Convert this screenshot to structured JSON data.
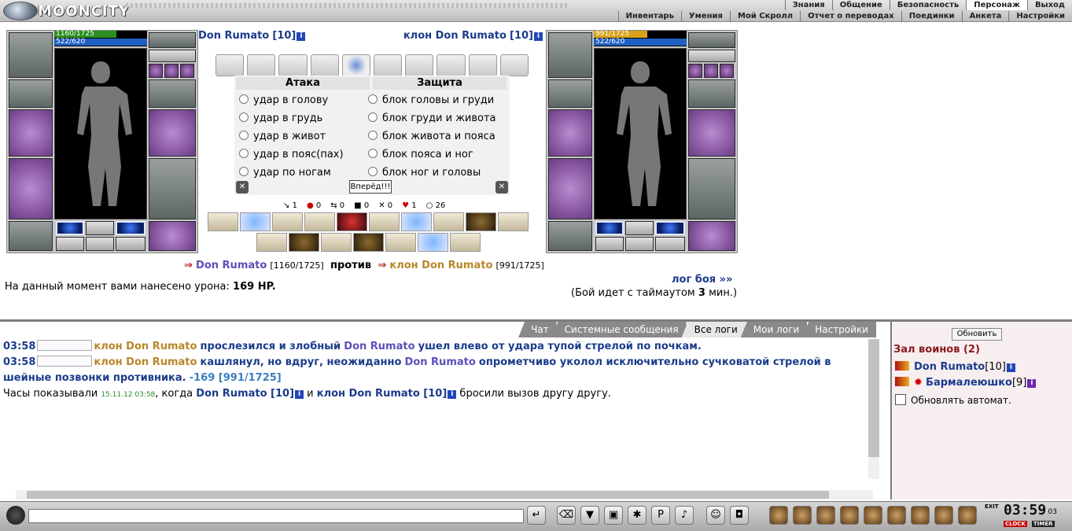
{
  "app": {
    "logo": "MOONCITY"
  },
  "top_menu": [
    "Знания",
    "Общение",
    "Безопасность",
    "Персонаж",
    "Выход"
  ],
  "top_menu_selected": "Персонаж",
  "sub_menu": [
    "Инвентарь",
    "Умения",
    "Мой Скролл",
    "Отчет о переводах",
    "Поединки",
    "Анкета",
    "Настройки"
  ],
  "player": {
    "name": "Don Rumato",
    "level": "[10]",
    "hp": "1160/1725",
    "mp": "522/620",
    "hp_fraction": 0.672
  },
  "enemy": {
    "name": "клон Don Rumato",
    "level": "[10]",
    "hp": "991/1725",
    "mp": "522/620",
    "hp_fraction": 0.575
  },
  "attack": {
    "header": "Атака",
    "options": [
      "удар в голову",
      "удар в грудь",
      "удар в живот",
      "удар в пояс(пах)",
      "удар по ногам"
    ]
  },
  "defense": {
    "header": "Защита",
    "options": [
      "блок головы и груди",
      "блок груди и живота",
      "блок живота и пояса",
      "блок пояса и ног",
      "блок ног и головы"
    ]
  },
  "forward_button": "Вперёд!!!",
  "stats": [
    "1",
    "0",
    "0",
    "0",
    "0",
    "1",
    "26"
  ],
  "versus": {
    "p1": "Don Rumato",
    "p1_hp": "[1160/1725]",
    "word": "против",
    "p2": "клон Don Rumato",
    "p2_hp": "[991/1725]"
  },
  "damage": {
    "prefix": "На данный момент вами нанесено урона:",
    "value": "169 HP."
  },
  "battle_log_link": "лог боя »»",
  "timeout": {
    "prefix": "(Бой идет с таймаутом",
    "value": "3",
    "suffix": "мин.)"
  },
  "chat_tabs": [
    "Чат",
    "Системные сообщения",
    "Все логи",
    "Мои логи",
    "Настройки"
  ],
  "chat_tab_selected": "Все логи",
  "log": {
    "l1": {
      "time": "03:58",
      "actor": "клон Don Rumato",
      "text1": "прослезился и злобный",
      "target": "Don Rumato",
      "text2": "ушел влево от удара тупой стрелой по почкам."
    },
    "l2": {
      "time": "03:58",
      "actor": "клон Don Rumato",
      "text1": "кашлянул, но вдруг, неожиданно",
      "target": "Don Rumato",
      "text2": "опрометчиво уколол исключительно сучковатой стрелой в",
      "text3": "шейные позвонки противника.",
      "damage": "-169 [991/1725]"
    },
    "l3": {
      "text1": "Часы показывали",
      "date": "15.11.12 03:58",
      "text2": ", когда",
      "p1": "Don Rumato [10]",
      "and": "и",
      "p2": "клон Don Rumato [10]",
      "text3": "бросили вызов другу другу."
    }
  },
  "right_panel": {
    "refresh": "Обновить",
    "hall_title": "Зал воинов (2)",
    "players": [
      {
        "name": "Don Rumato",
        "level": "[10]"
      },
      {
        "name": "Бармалеюшко",
        "level": "[9]"
      }
    ],
    "auto_refresh": "Обновлять автомат."
  },
  "clock": {
    "time": "03:59",
    "seconds": "03",
    "clock_label": "CLOCK",
    "timer_label": "TIMER",
    "exit": "EXIT"
  }
}
